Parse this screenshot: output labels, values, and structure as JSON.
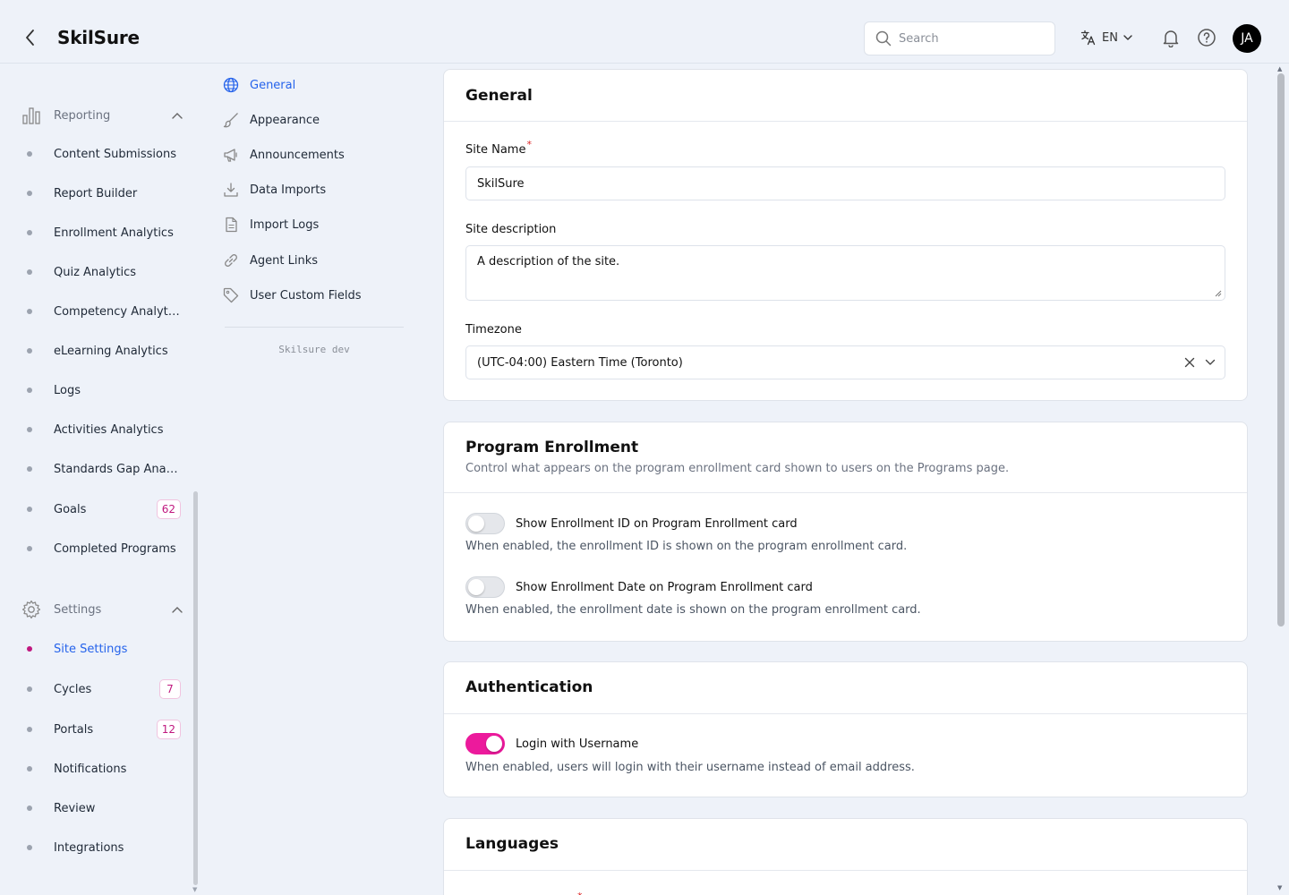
{
  "header": {
    "brand": "SkilSure",
    "search_placeholder": "Search",
    "language": "EN",
    "avatar_initials": "JA"
  },
  "sidebar": {
    "reporting": {
      "label": "Reporting",
      "items": [
        {
          "label": "Content Submissions"
        },
        {
          "label": "Report Builder"
        },
        {
          "label": "Enrollment Analytics"
        },
        {
          "label": "Quiz Analytics"
        },
        {
          "label": "Competency Analytics"
        },
        {
          "label": "eLearning Analytics"
        },
        {
          "label": "Logs"
        },
        {
          "label": "Activities Analytics"
        },
        {
          "label": "Standards Gap Analysis"
        },
        {
          "label": "Goals",
          "badge": "62"
        },
        {
          "label": "Completed Programs"
        }
      ]
    },
    "settings": {
      "label": "Settings",
      "items": [
        {
          "label": "Site Settings"
        },
        {
          "label": "Cycles",
          "badge": "7"
        },
        {
          "label": "Portals",
          "badge": "12"
        },
        {
          "label": "Notifications"
        },
        {
          "label": "Review"
        },
        {
          "label": "Integrations"
        }
      ]
    }
  },
  "subnav": {
    "items": [
      {
        "label": "General",
        "icon": "globe-icon"
      },
      {
        "label": "Appearance",
        "icon": "brush-icon"
      },
      {
        "label": "Announcements",
        "icon": "megaphone-icon"
      },
      {
        "label": "Data Imports",
        "icon": "download-icon"
      },
      {
        "label": "Import Logs",
        "icon": "document-icon"
      },
      {
        "label": "Agent Links",
        "icon": "link-icon"
      },
      {
        "label": "User Custom Fields",
        "icon": "tag-icon"
      }
    ],
    "env_label": "Skilsure dev"
  },
  "general": {
    "title": "General",
    "site_name_label": "Site Name",
    "site_name_value": "SkilSure",
    "site_description_label": "Site description",
    "site_description_value": "A description of the site.",
    "timezone_label": "Timezone",
    "timezone_value": "(UTC-04:00) Eastern Time (Toronto)"
  },
  "program_enrollment": {
    "title": "Program Enrollment",
    "subtitle": "Control what appears on the program enrollment card shown to users on the Programs page.",
    "toggles": [
      {
        "label": "Show Enrollment ID on Program Enrollment card",
        "description": "When enabled, the enrollment ID is shown on the program enrollment card.",
        "on": false
      },
      {
        "label": "Show Enrollment Date on Program Enrollment card",
        "description": "When enabled, the enrollment date is shown on the program enrollment card.",
        "on": false
      }
    ]
  },
  "authentication": {
    "title": "Authentication",
    "toggles": [
      {
        "label": "Login with Username",
        "description": "When enabled, users will login with their username instead of email address.",
        "on": true
      }
    ]
  },
  "languages": {
    "title": "Languages"
  },
  "colors": {
    "accent": "#ec1a9c",
    "link": "#2563eb",
    "badge": "#c0187f"
  }
}
